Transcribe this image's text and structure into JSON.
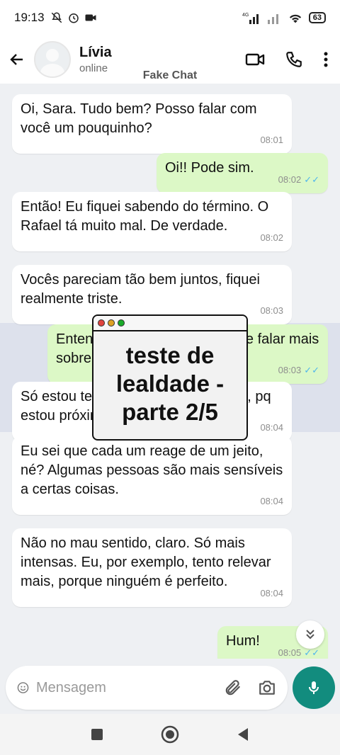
{
  "status_bar": {
    "time": "19:13",
    "network": "4G",
    "battery": "63"
  },
  "header": {
    "contact_name": "Lívia",
    "contact_status": "online",
    "app_label": "Fake Chat"
  },
  "messages": [
    {
      "dir": "in",
      "text": "Oi, Sara. Tudo bem? Posso falar com você um pouquinho?",
      "time": "08:01"
    },
    {
      "dir": "out",
      "text": "Oi!! Pode sim.",
      "time": "08:02"
    },
    {
      "dir": "in",
      "text": "Então! Eu fiquei sabendo do término. O Rafael tá muito mal. De verdade.",
      "time": "08:02"
    },
    {
      "dir": "in",
      "text": "Vocês pareciam tão bem juntos, fiquei realmente triste.",
      "time": "08:03"
    },
    {
      "dir": "out",
      "text": "Entendo... mas prefiro evitar de falar mais sobre isso.",
      "time": "08:03"
    },
    {
      "dir": "in",
      "text": "Só estou te dizendo porque sei bem, pq estou próxima a ele.",
      "time": "08:04"
    },
    {
      "dir": "in",
      "text": "Eu sei que cada um reage de um jeito, né? Algumas pessoas são mais sensíveis a certas coisas.",
      "time": "08:04"
    },
    {
      "dir": "in",
      "text": "Não no mau sentido, claro. Só mais intensas. Eu, por exemplo, tento relevar mais, porque ninguém é perfeito.",
      "time": "08:04"
    },
    {
      "dir": "out",
      "text": "Hum!",
      "time": "08:05"
    }
  ],
  "overlay": {
    "line1": "teste de",
    "line2": "lealdade -",
    "line3": "parte 2/5",
    "dot_colors": [
      "#e0443e",
      "#dea123",
      "#1aab29"
    ]
  },
  "composer": {
    "placeholder": "Mensagem"
  },
  "icons": {
    "back": "arrow-left-icon",
    "video": "video-call-icon",
    "call": "phone-icon",
    "menu": "more-vert-icon",
    "emoji": "emoji-icon",
    "attach": "paperclip-icon",
    "camera": "camera-icon",
    "mic": "mic-icon"
  },
  "colors": {
    "accent": "#128c7e",
    "outgoing_bubble": "#dcf8c6",
    "read_ticks": "#4fb6ec"
  }
}
